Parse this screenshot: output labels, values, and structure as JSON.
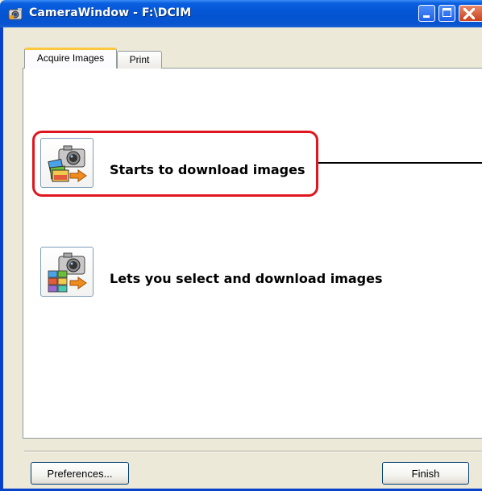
{
  "window": {
    "title": "CameraWindow - F:\\DCIM",
    "title_icon": "camerawindow-app-icon",
    "controls": [
      "minimize-icon",
      "maximize-icon",
      "close-icon"
    ]
  },
  "tabs": [
    {
      "label": "Acquire Images",
      "selected": true
    },
    {
      "label": "Print",
      "selected": false
    }
  ],
  "actions": {
    "download": {
      "label": "Starts to download images",
      "icon": "camera-download-icon",
      "highlighted": true
    },
    "select": {
      "label": "Lets you select and download images",
      "icon": "camera-select-icon"
    }
  },
  "footer": {
    "preferences_label": "Preferences...",
    "finish_label": "Finish"
  },
  "colors": {
    "titlebar": "#0556d6",
    "highlight": "#e0161e",
    "tab_accent": "#ffc83c"
  }
}
